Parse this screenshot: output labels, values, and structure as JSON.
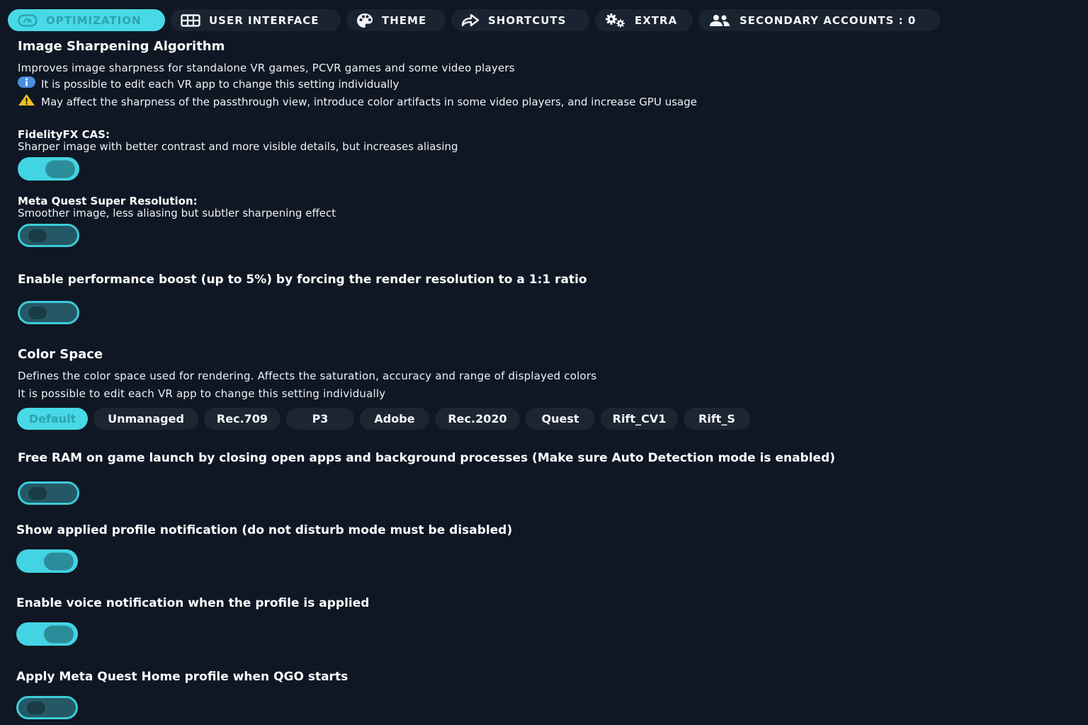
{
  "tabs": [
    {
      "label": "OPTIMIZATION",
      "icon": "gauge-icon",
      "active": true
    },
    {
      "label": "USER INTERFACE",
      "icon": "grid-icon",
      "active": false
    },
    {
      "label": "THEME",
      "icon": "palette-icon",
      "active": false
    },
    {
      "label": "SHORTCUTS",
      "icon": "share-arrow-icon",
      "active": false
    },
    {
      "label": "EXTRA",
      "icon": "gears-icon",
      "active": false
    },
    {
      "label": "SECONDARY ACCOUNTS : 0",
      "icon": "accounts-icon",
      "active": false
    }
  ],
  "sharpening": {
    "title": "Image Sharpening Algorithm",
    "desc": "Improves image sharpness for standalone VR games, PCVR games and some video players",
    "info_note": "It is possible to edit each VR app to change this setting individually",
    "warn_note": "May affect the sharpness of the passthrough view, introduce color artifacts in some video players, and increase GPU usage",
    "fidelity_title": "FidelityFX CAS:",
    "fidelity_desc": "Sharper image with better contrast and more visible details, but increases aliasing",
    "fidelity_on": true,
    "superres_title": "Meta Quest Super Resolution:",
    "superres_desc": "Smoother image, less aliasing but subtler sharpening effect",
    "superres_on": false
  },
  "perf_boost": {
    "title": "Enable performance boost (up to 5%) by forcing the render resolution to a 1:1 ratio",
    "on": false
  },
  "color_space": {
    "title": "Color Space",
    "desc": "Defines the color space used for rendering. Affects the saturation, accuracy and range of displayed colors",
    "note": "It is possible to edit each VR app to change this setting individually",
    "options": [
      "Default",
      "Unmanaged",
      "Rec.709",
      "P3",
      "Adobe",
      "Rec.2020",
      "Quest",
      "Rift_CV1",
      "Rift_S"
    ],
    "selected": "Default"
  },
  "free_ram": {
    "title": "Free RAM on game launch by closing open apps and background processes (Make sure Auto Detection mode is enabled)",
    "on": false
  },
  "profile_notification": {
    "title": "Show applied profile notification (do not disturb mode must be disabled)",
    "on": true
  },
  "voice_notification": {
    "title": "Enable voice notification when the profile is applied",
    "on": true
  },
  "home_profile": {
    "title": "Apply Meta Quest Home profile when QGO starts",
    "on": false
  },
  "colors": {
    "background": "#0f1724",
    "accent": "#47d9e6",
    "tab_bg": "#1a2330"
  }
}
